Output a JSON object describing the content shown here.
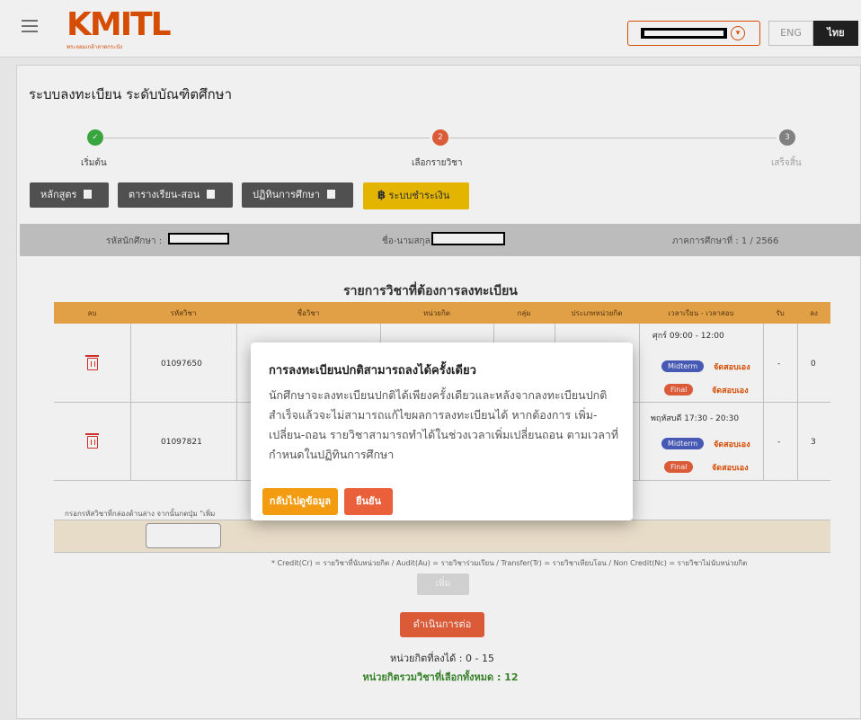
{
  "header": {
    "logo_text": "KMITL",
    "logo_subtext": "พระจอมเกล้าลาดกระบัง",
    "lang_en": "ENG",
    "lang_th": "ไทย"
  },
  "page": {
    "title": "ระบบลงทะเบียน ระดับบัณฑิตศึกษา"
  },
  "stepper": [
    {
      "number": "✓",
      "label": "เริ่มต้น",
      "state": "done",
      "color": "#3cb043"
    },
    {
      "number": "2",
      "label": "เลือกรายวิชา",
      "state": "active",
      "color": "#e9603b"
    },
    {
      "number": "3",
      "label": "เสร็จสิ้น",
      "state": "pending",
      "color": "#888888"
    }
  ],
  "nav_buttons": {
    "curriculum": "หลักสูตร",
    "schedule": "ตารางเรียน-สอน",
    "calendar": "ปฏิทินการศึกษา",
    "payment": "ระบบชำระเงิน"
  },
  "student_info": {
    "id_label": "รหัสนักศึกษา :",
    "name_label": "ชื่อ-นามสกุล :",
    "term": "ภาคการศึกษาที่ : 1 / 2566"
  },
  "table": {
    "title": "รายการวิชาที่ต้องการลงทะเบียน",
    "columns": [
      "ลบ",
      "รหัสวิชา",
      "ชื่อวิชา",
      "หน่วยกิต",
      "กลุ่ม",
      "ประเภทหน่วยกิต",
      "เวลาเรียน - เวลาสอบ",
      "รับ",
      "ลง"
    ],
    "rows": [
      {
        "code": "01097650",
        "time": "ศุกร์ 09:00 - 12:00",
        "midterm": "Midterm",
        "final": "Final",
        "exam_note": "จัดสอบเอง",
        "accept": "-",
        "registered": "0"
      },
      {
        "code": "01097821",
        "time": "พฤหัสบดี 17:30 - 20:30",
        "midterm": "Midterm",
        "final": "Final",
        "exam_note": "จัดสอบเอง",
        "accept": "-",
        "registered": "3"
      }
    ],
    "input_hint": "กรอกรหัสวิชาที่กล่องด้านล่าง จากนั้นกดปุ่ม \"เพิ่ม",
    "footnote": "* Credit(Cr) = รายวิชาที่นับหน่วยกิต / Audit(Au) = รายวิชาร่วมเรียน / Transfer(Tr) = รายวิชาเทียบโอน / Non Credit(Nc) = รายวิชาไม่นับหน่วยกิต",
    "add_button": "เพิ่ม"
  },
  "actions": {
    "continue": "ดำเนินการต่อ",
    "credits_allowed": "หน่วยกิตที่ลงได้ : 0 - 15",
    "credits_total": "หน่วยกิตรวมวิชาที่เลือกทั้งหมด : 12"
  },
  "modal": {
    "title": "การลงทะเบียนปกติสามารถลงได้ครั้งเดียว",
    "body": "นักศึกษาจะลงทะเบียนปกติได้เพียงครั้งเดียวและหลังจากลงทะเบียนปกติสำเร็จแล้วจะไม่สามารถแก้ไขผลการลงทะเบียนได้ หากต้องการ เพิ่ม-เปลี่ยน-ถอน รายวิชาสามารถทำได้ในช่วงเวลาเพิ่มเปลี่ยนถอน ตามเวลาที่กำหนดในปฏิทินการศึกษา",
    "back_button": "กลับไปดูข้อมูล",
    "confirm_button": "ยืนยัน"
  },
  "colors": {
    "brand_orange": "#e35205",
    "table_header": "#f0a94b",
    "payment_yellow": "#f2c100",
    "midterm_blue": "#4a5fc1",
    "final_red": "#e9603b",
    "success_green": "#3cb043"
  }
}
